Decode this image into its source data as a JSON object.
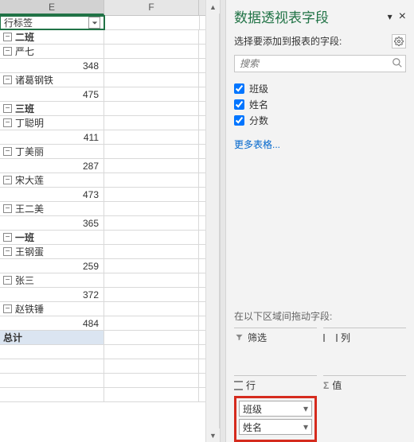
{
  "sheet": {
    "columns": {
      "E": "E",
      "F": "F"
    },
    "rowLabel": "行标签",
    "groups": [
      {
        "name": "二班",
        "children": [
          {
            "name": "严七",
            "value": 348
          },
          {
            "name": "诸葛钢铁",
            "value": 475
          }
        ]
      },
      {
        "name": "三班",
        "children": [
          {
            "name": "丁聪明",
            "value": 411
          },
          {
            "name": "丁美丽",
            "value": 287
          },
          {
            "name": "宋大莲",
            "value": 473
          },
          {
            "name": "王二美",
            "value": 365
          }
        ]
      },
      {
        "name": "一班",
        "children": [
          {
            "name": "王钢蛋",
            "value": 259
          },
          {
            "name": "张三",
            "value": 372
          },
          {
            "name": "赵铁锤",
            "value": 484
          }
        ]
      }
    ],
    "totalLabel": "总计"
  },
  "pane": {
    "title": "数据透视表字段",
    "subtitle": "选择要添加到报表的字段:",
    "searchPlaceholder": "搜索",
    "fields": [
      {
        "label": "班级",
        "checked": true
      },
      {
        "label": "姓名",
        "checked": true
      },
      {
        "label": "分数",
        "checked": true
      }
    ],
    "moreTables": "更多表格...",
    "areasHint": "在以下区域间拖动字段:",
    "areas": {
      "filter": "筛选",
      "columns": "列",
      "rows": "行",
      "values": "值"
    },
    "rowChips": [
      "班级",
      "姓名"
    ]
  }
}
